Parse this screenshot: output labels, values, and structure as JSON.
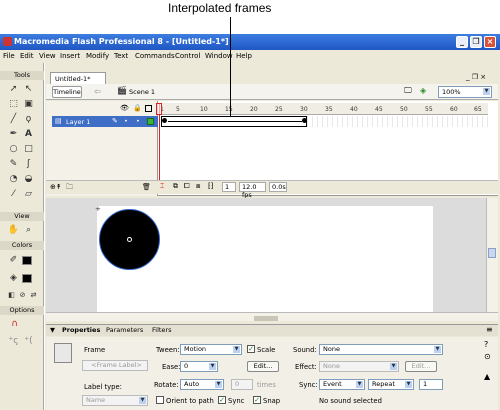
{
  "callout": {
    "label": "Interpolated frames"
  },
  "window": {
    "title": "Macromedia Flash Professional 8 - [Untitled-1*]",
    "minimize": "_",
    "restore": "❐",
    "close": "×"
  },
  "menu": [
    "File",
    "Edit",
    "View",
    "Insert",
    "Modify",
    "Text",
    "Commands",
    "Control",
    "Window",
    "Help"
  ],
  "tools_panel": {
    "tools_header": "Tools",
    "view_header": "View",
    "colors_header": "Colors",
    "options_header": "Options"
  },
  "document": {
    "tab_label": "Untitled-1*",
    "timeline_button": "Timeline",
    "scene_label": "Scene 1",
    "zoom": "100%"
  },
  "timeline": {
    "ruler": [
      "1",
      "5",
      "10",
      "15",
      "20",
      "25",
      "30",
      "35",
      "40",
      "45",
      "50",
      "55",
      "60",
      "65"
    ],
    "layer_name": "Layer 1",
    "current_frame": "1",
    "frame_rate": "12.0 fps",
    "elapsed": "0.0s"
  },
  "properties": {
    "tabs": [
      "Properties",
      "Parameters",
      "Filters"
    ],
    "frame_label": "Frame",
    "frame_label_placeholder": "<Frame Label>",
    "label_type_label": "Label type:",
    "label_type_value": "Name",
    "tween_label": "Tween:",
    "tween_value": "Motion",
    "scale_label": "Scale",
    "ease_label": "Ease:",
    "ease_value": "0",
    "edit_button": "Edit...",
    "rotate_label": "Rotate:",
    "rotate_value": "Auto",
    "rotate_times_value": "0",
    "times_label": "times",
    "orient_label": "Orient to path",
    "sync_label": "Sync",
    "snap_label": "Snap",
    "sound_label": "Sound:",
    "sound_value": "None",
    "effect_label": "Effect:",
    "effect_value": "None",
    "effect_edit_button": "Edit...",
    "sync_sound_label": "Sync:",
    "sync_value": "Event",
    "repeat_value": "Repeat",
    "repeat_count": "1",
    "status": "No sound selected"
  },
  "colors": {
    "accent": "#1f56c4",
    "selection": "#3f6ec6",
    "playhead": "#dd2222"
  }
}
